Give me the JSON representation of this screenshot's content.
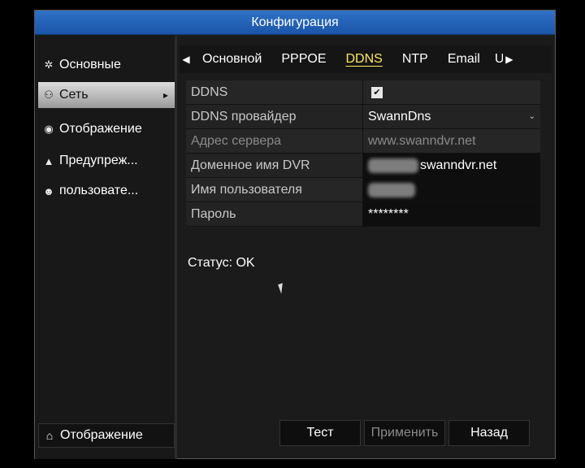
{
  "window": {
    "title": "Конфигурация"
  },
  "sidebar": {
    "items": [
      {
        "label": "Основные",
        "icon": "gear-icon"
      },
      {
        "label": "Сеть",
        "icon": "network-icon",
        "active": true
      },
      {
        "label": "Отображение",
        "icon": "eye-icon"
      },
      {
        "label": "Предупреж...",
        "icon": "warning-icon"
      },
      {
        "label": "пользовате...",
        "icon": "users-icon"
      }
    ],
    "bottom": {
      "label": "Отображение",
      "icon": "home-icon"
    }
  },
  "tabs": {
    "items": [
      "Основной",
      "PPPOE",
      "DDNS",
      "NTP",
      "Email",
      "U"
    ],
    "active": "DDNS"
  },
  "form": {
    "rows": [
      {
        "label": "DDNS",
        "value": "",
        "type": "checkbox",
        "checked": true
      },
      {
        "label": "DDNS провайдер",
        "value": "SwannDns",
        "type": "select"
      },
      {
        "label": "Адрес сервера",
        "value": "www.swanndvr.net",
        "disabled": true
      },
      {
        "label": "Доменное имя DVR",
        "value": "swanndvr.net",
        "type": "input"
      },
      {
        "label": "Имя пользователя",
        "value": "",
        "type": "input"
      },
      {
        "label": "Пароль",
        "value": "********",
        "type": "password"
      }
    ]
  },
  "status": {
    "text": "Статус: OK"
  },
  "buttons": {
    "test": "Тест",
    "apply": "Применить",
    "back": "Назад"
  },
  "colors": {
    "titlebar": "#1f5fb3",
    "active_tab": "#ffe85a"
  }
}
